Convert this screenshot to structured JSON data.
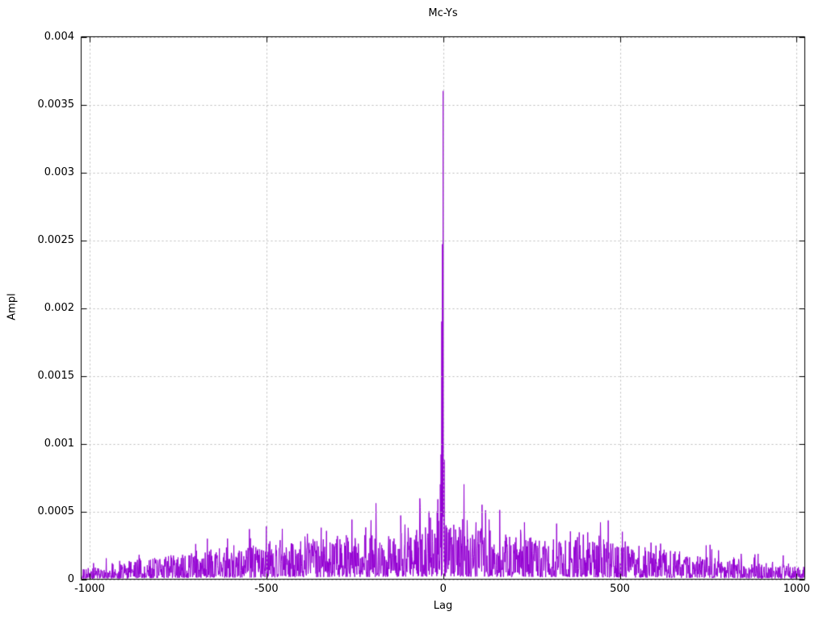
{
  "chart_data": {
    "type": "line",
    "title": "Mc-Ys",
    "xlabel": "Lag",
    "ylabel": "Ampl",
    "xlim": [
      -1024,
      1023
    ],
    "ylim": [
      0,
      0.004
    ],
    "xticks": [
      {
        "label": "-1000",
        "value": -1000
      },
      {
        "label": "-500",
        "value": -500
      },
      {
        "label": "0",
        "value": 0
      },
      {
        "label": "500",
        "value": 500
      },
      {
        "label": "1000",
        "value": 1000
      }
    ],
    "yticks": [
      {
        "label": "0",
        "value": 0
      },
      {
        "label": "0.0005",
        "value": 0.0005
      },
      {
        "label": "0.001",
        "value": 0.001
      },
      {
        "label": "0.0015",
        "value": 0.0015
      },
      {
        "label": "0.002",
        "value": 0.002
      },
      {
        "label": "0.0025",
        "value": 0.0025
      },
      {
        "label": "0.003",
        "value": 0.003
      },
      {
        "label": "0.0035",
        "value": 0.0035
      },
      {
        "label": "0.004",
        "value": 0.004
      }
    ],
    "grid": true,
    "legend": "none",
    "line_color": "#9400d3",
    "grid_color": "#bbbbbb",
    "border_color": "#000000",
    "background_color": "#ffffff",
    "main_peak": {
      "lag": 0,
      "ampl": 0.0036
    },
    "notable_peaks": [
      {
        "lag": 0,
        "ampl": 0.0036
      },
      {
        "lag": -2,
        "ampl": 0.00247
      },
      {
        "lag": -4,
        "ampl": 0.0019
      },
      {
        "lag": -6,
        "ampl": 0.00092
      },
      {
        "lag": 3,
        "ampl": 0.00088
      },
      {
        "lag": -8,
        "ampl": 0.0007
      },
      {
        "lag": 59,
        "ampl": 0.0007
      },
      {
        "lag": -190,
        "ampl": 0.00056
      },
      {
        "lag": -65,
        "ampl": 0.00053
      },
      {
        "lag": -40,
        "ampl": 0.0005
      },
      {
        "lag": -17,
        "ampl": 0.0005
      },
      {
        "lag": -120,
        "ampl": 0.00047
      },
      {
        "lag": -258,
        "ampl": 0.00044
      },
      {
        "lag": 130,
        "ampl": 0.00044
      },
      {
        "lag": 93,
        "ampl": 0.00042
      },
      {
        "lag": 230,
        "ampl": 0.00042
      },
      {
        "lag": 445,
        "ampl": 0.00042
      },
      {
        "lag": 321,
        "ampl": 0.00041
      },
      {
        "lag": -500,
        "ampl": 0.00039
      },
      {
        "lag": -345,
        "ampl": 0.00038
      },
      {
        "lag": 507,
        "ampl": 0.00035
      },
      {
        "lag": -610,
        "ampl": 0.0003
      },
      {
        "lag": 588,
        "ampl": 0.00027
      },
      {
        "lag": -700,
        "ampl": 0.00026
      },
      {
        "lag": 760,
        "ampl": 0.00022
      },
      {
        "lag": -860,
        "ampl": 0.00018
      },
      {
        "lag": 880,
        "ampl": 0.00016
      }
    ],
    "noise_envelope": {
      "lags": [
        -1024,
        -1000,
        -900,
        -800,
        -700,
        -600,
        -500,
        -400,
        -300,
        -200,
        -100,
        -50,
        0,
        50,
        100,
        200,
        300,
        400,
        500,
        600,
        700,
        800,
        900,
        1000,
        1023
      ],
      "typical": [
        5e-05,
        6e-05,
        8e-05,
        0.00011,
        0.00013,
        0.000145,
        0.00016,
        0.000185,
        0.000205,
        0.000215,
        0.000235,
        0.00025,
        0.00026,
        0.00025,
        0.000235,
        0.000215,
        0.000205,
        0.000195,
        0.000165,
        0.00014,
        0.000115,
        9.5e-05,
        8e-05,
        6.5e-05,
        6e-05
      ]
    },
    "noise_seed": 1234567
  }
}
